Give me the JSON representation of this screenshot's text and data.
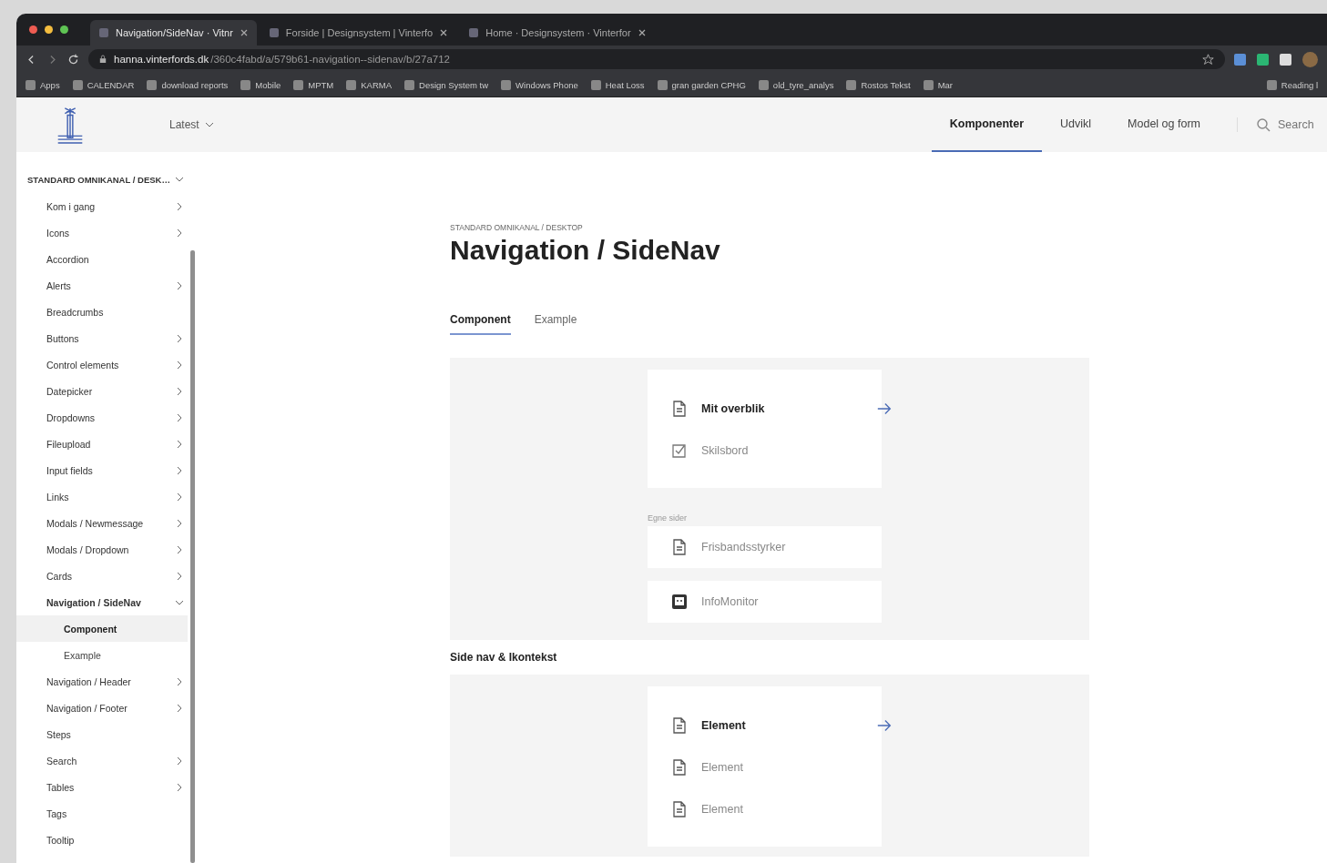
{
  "browser": {
    "tabs": [
      {
        "title": "Navigation/SideNav · Vitnr",
        "selected": true
      },
      {
        "title": "Forside | Designsystem | Vinterfo",
        "selected": false
      },
      {
        "title": "Home · Designsystem · Vinterfor",
        "selected": false
      }
    ],
    "url_host": "hanna.vinterfords.dk",
    "url_path": "/360c4fabd/a/579b61-navigation--sidenav/b/27a712",
    "bookmarks": [
      "Apps",
      "CALENDAR",
      "download reports",
      "Mobile",
      "MPTM",
      "KARMA",
      "Design System tw",
      "Windows Phone",
      "Heat Loss",
      "gran garden CPHG",
      "old_tyre_analys",
      "Rostos Tekst",
      "Mar"
    ],
    "reading_list": "Reading l"
  },
  "header": {
    "version": "Latest",
    "nav": [
      {
        "label": "Komponenter",
        "selected": true
      },
      {
        "label": "Udvikl",
        "selected": false
      },
      {
        "label": "Model og form",
        "selected": false
      }
    ],
    "search": {
      "placeholder": "Search"
    }
  },
  "sidebar": {
    "title": "STANDARD OMNIKANAL / DESK…",
    "items": [
      {
        "label": "Kom i gang",
        "kind": "folder",
        "expanded": false
      },
      {
        "label": "Icons",
        "kind": "folder",
        "expanded": false
      },
      {
        "label": "Accordion",
        "kind": "page"
      },
      {
        "label": "Alerts",
        "kind": "folder",
        "expanded": false
      },
      {
        "label": "Breadcrumbs",
        "kind": "page"
      },
      {
        "label": "Buttons",
        "kind": "folder",
        "expanded": false
      },
      {
        "label": "Control elements",
        "kind": "folder",
        "expanded": false
      },
      {
        "label": "Datepicker",
        "kind": "folder",
        "expanded": false
      },
      {
        "label": "Dropdowns",
        "kind": "folder",
        "expanded": false
      },
      {
        "label": "Fileupload",
        "kind": "folder",
        "expanded": false
      },
      {
        "label": "Input fields",
        "kind": "folder",
        "expanded": false
      },
      {
        "label": "Links",
        "kind": "folder",
        "expanded": false
      },
      {
        "label": "Modals / Newmessage",
        "kind": "folder",
        "expanded": false
      },
      {
        "label": "Modals / Dropdown",
        "kind": "folder",
        "expanded": false
      },
      {
        "label": "Cards",
        "kind": "folder",
        "expanded": false
      },
      {
        "label": "Navigation / SideNav",
        "kind": "folder",
        "expanded": true,
        "children": [
          {
            "label": "Component",
            "selected": true
          },
          {
            "label": "Example",
            "selected": false
          }
        ]
      },
      {
        "label": "Navigation / Header",
        "kind": "folder",
        "expanded": false
      },
      {
        "label": "Navigation / Footer",
        "kind": "folder",
        "expanded": false
      },
      {
        "label": "Steps",
        "kind": "page"
      },
      {
        "label": "Search",
        "kind": "folder",
        "expanded": false
      },
      {
        "label": "Tables",
        "kind": "folder",
        "expanded": false
      },
      {
        "label": "Tags",
        "kind": "page"
      },
      {
        "label": "Tooltip",
        "kind": "page"
      }
    ]
  },
  "page": {
    "breadcrumb": "STANDARD OMNIKANAL / DESKTOP",
    "title": "Navigation / SideNav",
    "tabs": [
      {
        "label": "Component",
        "selected": true
      },
      {
        "label": "Example",
        "selected": false
      }
    ],
    "demo_1": {
      "menu": [
        {
          "label": "Mit overblik",
          "kind": "document",
          "selected": true
        },
        {
          "label": "Skilsbord",
          "kind": "checklist",
          "selected": false
        }
      ],
      "group_label": "Egne sider",
      "group": [
        {
          "label": "Frisbandsstyrker",
          "kind": "document",
          "selected": false
        },
        {
          "label": "InfoMonitor",
          "kind": "monitor",
          "selected": false
        }
      ]
    },
    "section_title": "Side nav & Ikontekst",
    "demo_2": {
      "menu": [
        {
          "label": "Element",
          "kind": "document",
          "selected": true
        },
        {
          "label": "Element",
          "kind": "document",
          "selected": false
        },
        {
          "label": "Element",
          "kind": "document",
          "selected": false
        }
      ]
    }
  }
}
